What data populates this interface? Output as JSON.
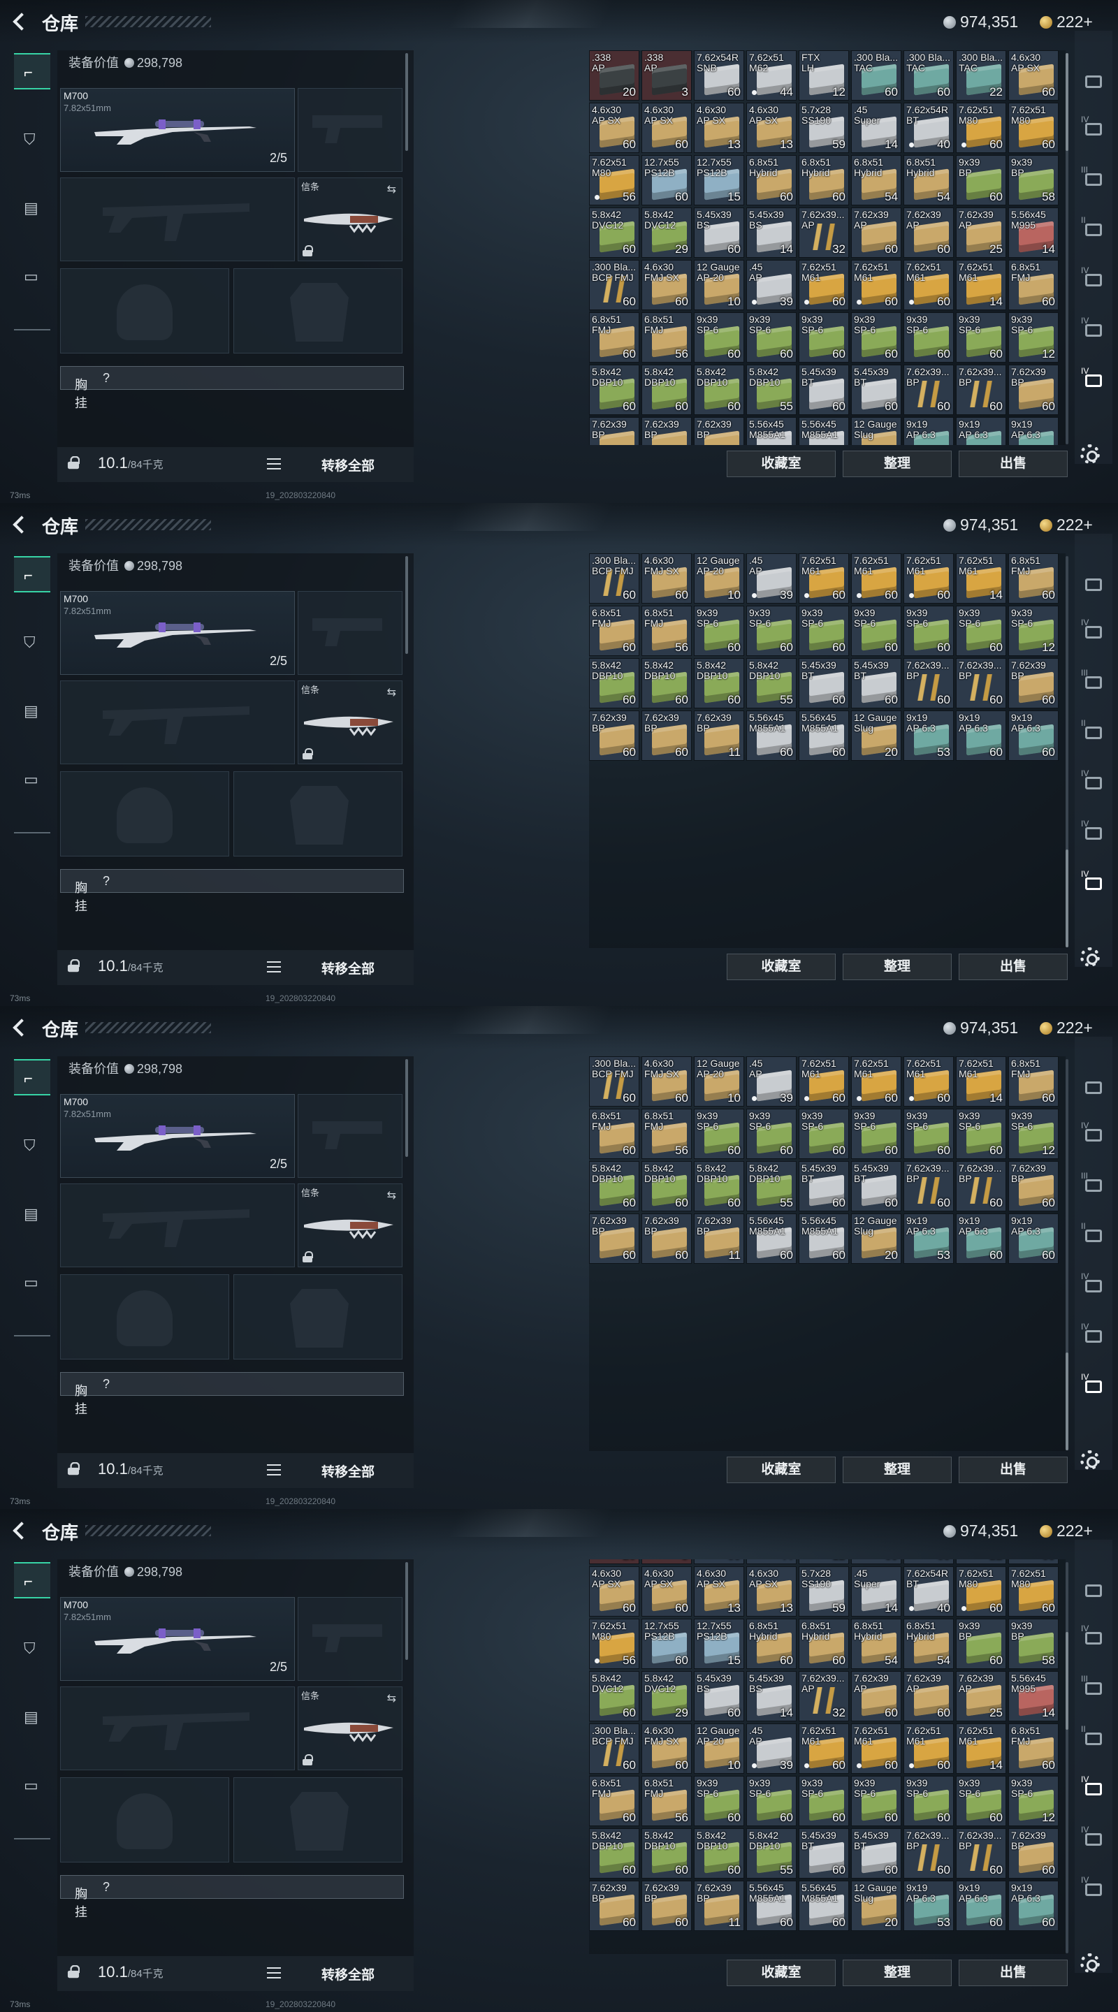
{
  "app": {
    "title": "仓库",
    "back_icon": "back-arrow-icon"
  },
  "currency": {
    "silver": "974,351",
    "gold": "222+"
  },
  "left_tabs": [
    "weapon-tab",
    "armor-tab",
    "container-tab",
    "backpack-tab"
  ],
  "loadout": {
    "value_label": "装备价值",
    "value": "298,798",
    "primary": {
      "name": "M700",
      "caliber": "7.82x51mm",
      "count": "2/5"
    },
    "melee_tag": "信条",
    "chest_label": "胸挂",
    "chest_hint": "?",
    "weight": "10.1",
    "capacity": "/84千克",
    "transfer_all": "转移全部"
  },
  "actions": {
    "collection": "收藏室",
    "sort": "整理",
    "sell": "出售"
  },
  "status": {
    "ping": "73ms",
    "build": "19_202803220840"
  },
  "right_rail": [
    "IV",
    "III",
    "II",
    "IV",
    "IV",
    "IV"
  ],
  "colors": {
    "accent": "#37d4a6",
    "gold": "#d9b458"
  },
  "grid": {
    "rows": [
      [
        [
          "t3",
          ".338\nAP",
          "20",
          "dark",
          0
        ],
        [
          "t3",
          ".338\nAP",
          "3",
          "dark",
          0
        ],
        [
          "t1",
          "7.62x54R\nSNB",
          "60",
          "white",
          0
        ],
        [
          "t1",
          "7.62x51\nM62",
          "44",
          "white",
          1
        ],
        [
          "t1",
          "FTX\nLH",
          "12",
          "white",
          0
        ],
        [
          "t1",
          ".300 Bla...\nTAC",
          "60",
          "teal",
          0
        ],
        [
          "t1",
          ".300 Bla...\nTAC",
          "60",
          "teal",
          0
        ],
        [
          "t1",
          ".300 Bla...\nTAC",
          "22",
          "teal",
          0
        ],
        [
          "t1",
          "4.6x30\nAP SX",
          "60",
          "tan",
          0
        ]
      ],
      [
        [
          "t1",
          "4.6x30\nAP SX",
          "60",
          "tan",
          0
        ],
        [
          "t1",
          "4.6x30\nAP SX",
          "60",
          "tan",
          0
        ],
        [
          "t1",
          "4.6x30\nAP SX",
          "13",
          "tan",
          0
        ],
        [
          "t1",
          "4.6x30\nAP SX",
          "13",
          "tan",
          0
        ],
        [
          "t1",
          "5.7x28\nSS190",
          "59",
          "white",
          0
        ],
        [
          "t1",
          ".45\nSuper",
          "14",
          "white",
          0
        ],
        [
          "t1",
          "7.62x54R\nBT",
          "40",
          "white",
          1
        ],
        [
          "t1",
          "7.62x51\nM80",
          "60",
          "orange",
          1
        ],
        [
          "t1",
          "7.62x51\nM80",
          "60",
          "orange",
          0
        ]
      ],
      [
        [
          "t1",
          "7.62x51\nM80",
          "56",
          "orange",
          1
        ],
        [
          "t1",
          "12.7x55\nPS12B",
          "60",
          "blue",
          0
        ],
        [
          "t1",
          "12.7x55\nPS12B",
          "15",
          "blue",
          0
        ],
        [
          "t1",
          "6.8x51\nHybrid",
          "60",
          "tan",
          0
        ],
        [
          "t1",
          "6.8x51\nHybrid",
          "60",
          "tan",
          0
        ],
        [
          "t1",
          "6.8x51\nHybrid",
          "54",
          "tan",
          0
        ],
        [
          "t1",
          "6.8x51\nHybrid",
          "54",
          "tan",
          0
        ],
        [
          "t1",
          "9x39\nBP",
          "60",
          "green",
          0
        ],
        [
          "t1",
          "9x39\nBP",
          "58",
          "green",
          0
        ]
      ],
      [
        [
          "t1",
          "5.8x42\nDVC12",
          "60",
          "green",
          0
        ],
        [
          "t1",
          "5.8x42\nDVC12",
          "29",
          "green",
          0
        ],
        [
          "t1",
          "5.45x39\nBS",
          "60",
          "white",
          0
        ],
        [
          "t1",
          "5.45x39\nBS",
          "14",
          "white",
          0
        ],
        [
          "t1",
          "7.62x39...\nAP",
          "32",
          "brass",
          0
        ],
        [
          "t1",
          "7.62x39\nAP",
          "60",
          "tan",
          0
        ],
        [
          "t1",
          "7.62x39\nAP",
          "60",
          "tan",
          0
        ],
        [
          "t1",
          "7.62x39\nAP",
          "25",
          "tan",
          0
        ],
        [
          "t1",
          "5.56x45\nM995",
          "14",
          "red",
          0
        ]
      ],
      [
        [
          "t1",
          ".300 Bla...\nBCP FMJ",
          "60",
          "brass",
          0
        ],
        [
          "t1",
          "4.6x30\nFMJ SX",
          "60",
          "tan",
          0
        ],
        [
          "t1",
          "12 Gauge\nAP-20",
          "10",
          "tan",
          0
        ],
        [
          "t1",
          ".45\nAP",
          "39",
          "white",
          1
        ],
        [
          "t1",
          "7.62x51\nM61",
          "60",
          "orange",
          1
        ],
        [
          "t1",
          "7.62x51\nM61",
          "60",
          "orange",
          1
        ],
        [
          "t1",
          "7.62x51\nM61",
          "60",
          "orange",
          1
        ],
        [
          "t1",
          "7.62x51\nM61",
          "14",
          "orange",
          0
        ],
        [
          "t1",
          "6.8x51\nFMJ",
          "60",
          "tan",
          0
        ]
      ],
      [
        [
          "t1",
          "6.8x51\nFMJ",
          "60",
          "tan",
          0
        ],
        [
          "t1",
          "6.8x51\nFMJ",
          "56",
          "tan",
          0
        ],
        [
          "t1",
          "9x39\nSP-6",
          "60",
          "green",
          0
        ],
        [
          "t1",
          "9x39\nSP-6",
          "60",
          "green",
          0
        ],
        [
          "t1",
          "9x39\nSP-6",
          "60",
          "green",
          0
        ],
        [
          "t1",
          "9x39\nSP-6",
          "60",
          "green",
          0
        ],
        [
          "t1",
          "9x39\nSP-6",
          "60",
          "green",
          0
        ],
        [
          "t1",
          "9x39\nSP-6",
          "60",
          "green",
          0
        ],
        [
          "t1",
          "9x39\nSP-6",
          "12",
          "green",
          0
        ]
      ],
      [
        [
          "t1",
          "5.8x42\nDBP10",
          "60",
          "green",
          0
        ],
        [
          "t1",
          "5.8x42\nDBP10",
          "60",
          "green",
          0
        ],
        [
          "t1",
          "5.8x42\nDBP10",
          "60",
          "green",
          0
        ],
        [
          "t1",
          "5.8x42\nDBP10",
          "55",
          "green",
          0
        ],
        [
          "t1",
          "5.45x39\nBT",
          "60",
          "white",
          0
        ],
        [
          "t1",
          "5.45x39\nBT",
          "60",
          "white",
          0
        ],
        [
          "t1",
          "7.62x39...\nBP",
          "60",
          "brass",
          0
        ],
        [
          "t1",
          "7.62x39...\nBP",
          "60",
          "brass",
          0
        ],
        [
          "t1",
          "7.62x39\nBP",
          "60",
          "tan",
          0
        ]
      ],
      [
        [
          "t1",
          "7.62x39\nBP",
          "60",
          "tan",
          0
        ],
        [
          "t1",
          "7.62x39\nBP",
          "60",
          "tan",
          0
        ],
        [
          "t1",
          "7.62x39\nBP",
          "11",
          "tan",
          0
        ],
        [
          "t1",
          "5.56x45\nM855A1",
          "60",
          "white",
          0
        ],
        [
          "t1",
          "5.56x45\nM855A1",
          "60",
          "white",
          0
        ],
        [
          "t1",
          "12 Gauge\nSlug",
          "20",
          "tan",
          0
        ],
        [
          "t1",
          "9x19\nAP 6.3",
          "53",
          "teal",
          0
        ],
        [
          "t1",
          "9x19\nAP 6.3",
          "60",
          "teal",
          0
        ],
        [
          "t1",
          "9x19\nAP 6.3",
          "60",
          "teal",
          0
        ]
      ]
    ]
  }
}
